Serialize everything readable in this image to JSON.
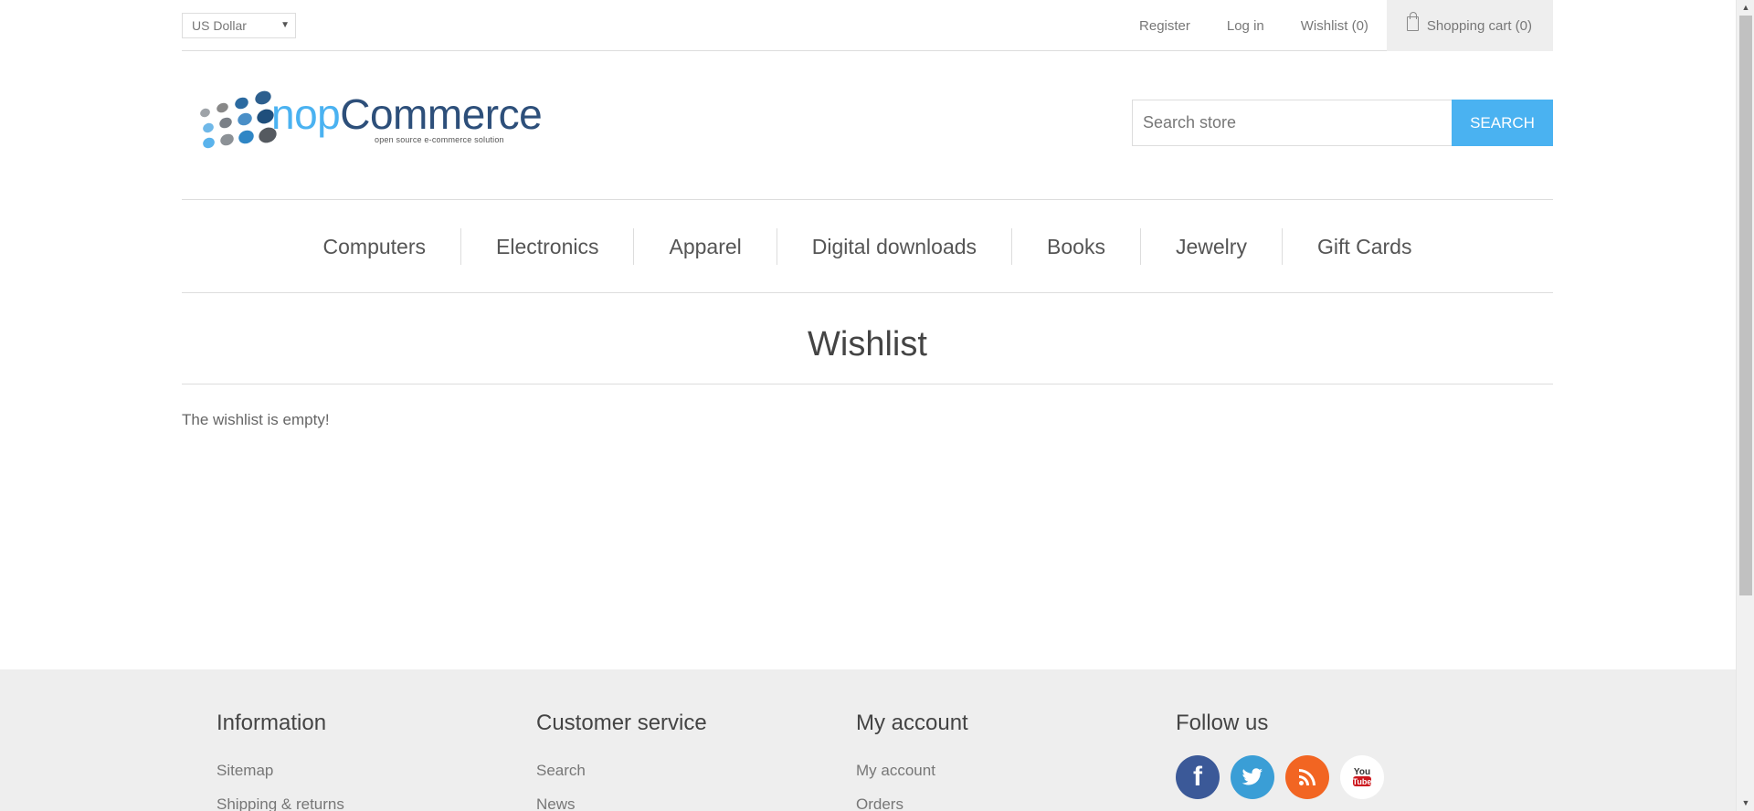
{
  "header": {
    "currency": "US Dollar",
    "links": {
      "register": "Register",
      "login": "Log in",
      "wishlist": "Wishlist (0)",
      "cart": "Shopping cart (0)"
    }
  },
  "logo": {
    "nop": "nop",
    "commerce": "Commerce",
    "tagline": "open source e-commerce solution"
  },
  "search": {
    "placeholder": "Search store",
    "button_label": "SEARCH"
  },
  "menu": {
    "items": [
      "Computers",
      "Electronics",
      "Apparel",
      "Digital downloads",
      "Books",
      "Jewelry",
      "Gift Cards"
    ]
  },
  "main": {
    "title": "Wishlist",
    "empty_message": "The wishlist is empty!"
  },
  "footer": {
    "information": {
      "title": "Information",
      "items": [
        "Sitemap",
        "Shipping & returns"
      ]
    },
    "customer_service": {
      "title": "Customer service",
      "items": [
        "Search",
        "News"
      ]
    },
    "my_account": {
      "title": "My account",
      "items": [
        "My account",
        "Orders"
      ]
    },
    "follow_us": {
      "title": "Follow us",
      "icons": [
        "facebook-icon",
        "twitter-icon",
        "rss-icon",
        "youtube-icon"
      ]
    }
  },
  "colors": {
    "accent": "#4ab2f1",
    "brand_dark": "#2d4f7a",
    "footer_bg": "#eeeeee"
  }
}
